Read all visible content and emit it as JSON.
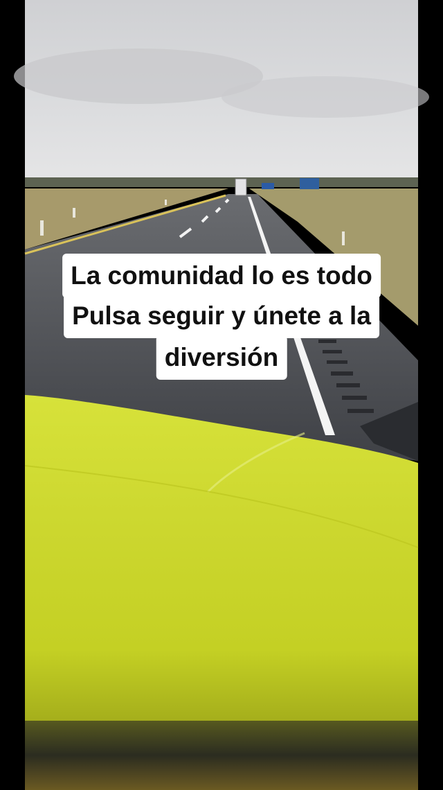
{
  "caption": {
    "lines": [
      "La comunidad lo es todo",
      "Pulsa seguir y únete a la",
      "diversión"
    ]
  },
  "colors": {
    "sky": "#d9dadc",
    "road": "#4b4d52",
    "grass": "#a79a6b",
    "hood": "#c9d62e",
    "letterbox": "#000000"
  }
}
